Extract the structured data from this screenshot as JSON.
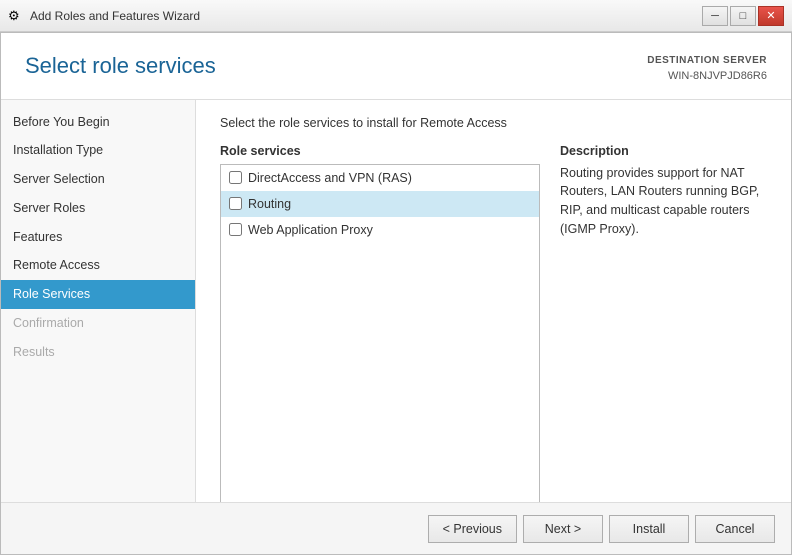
{
  "titleBar": {
    "title": "Add Roles and Features Wizard",
    "icon": "⚙",
    "controls": {
      "minimize": "─",
      "maximize": "□",
      "close": "✕"
    }
  },
  "header": {
    "title": "Select role services",
    "destinationLabel": "DESTINATION SERVER",
    "destinationName": "WIN-8NJVPJD86R6"
  },
  "sidebar": {
    "items": [
      {
        "label": "Before You Begin",
        "state": "normal"
      },
      {
        "label": "Installation Type",
        "state": "normal"
      },
      {
        "label": "Server Selection",
        "state": "normal"
      },
      {
        "label": "Server Roles",
        "state": "normal"
      },
      {
        "label": "Features",
        "state": "normal"
      },
      {
        "label": "Remote Access",
        "state": "normal"
      },
      {
        "label": "Role Services",
        "state": "active"
      },
      {
        "label": "Confirmation",
        "state": "dimmed"
      },
      {
        "label": "Results",
        "state": "dimmed"
      }
    ]
  },
  "content": {
    "description": "Select the role services to install for Remote Access",
    "roleServicesHeader": "Role services",
    "roleItems": [
      {
        "label": "DirectAccess and VPN (RAS)",
        "checked": false,
        "selected": false
      },
      {
        "label": "Routing",
        "checked": false,
        "selected": true
      },
      {
        "label": "Web Application Proxy",
        "checked": false,
        "selected": false
      }
    ],
    "descriptionHeader": "Description",
    "descriptionText": "Routing provides support for NAT Routers, LAN Routers running BGP, RIP, and multicast capable routers (IGMP Proxy)."
  },
  "footer": {
    "previousLabel": "< Previous",
    "nextLabel": "Next >",
    "installLabel": "Install",
    "cancelLabel": "Cancel"
  }
}
